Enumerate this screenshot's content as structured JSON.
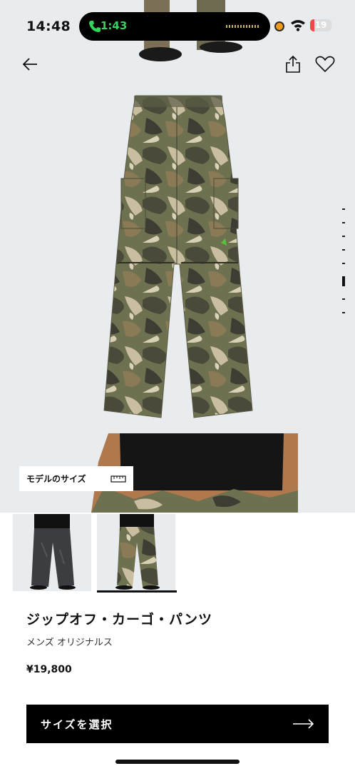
{
  "status_bar": {
    "time": "14:48",
    "call_time": "1:43",
    "battery": "19",
    "battery_level": 0.19
  },
  "nav": {
    "back_icon": "arrow-left-icon",
    "share_icon": "share-icon",
    "favorite_icon": "heart-icon"
  },
  "gallery": {
    "image_count": 8,
    "active_index": 6
  },
  "model_size": {
    "label": "モデルのサイズ",
    "icon": "ruler-icon"
  },
  "thumbnails": [
    {
      "colorway": "black"
    },
    {
      "colorway": "camo"
    }
  ],
  "product": {
    "title": "ジップオフ・カーゴ・パンツ",
    "category": "メンズ オリジナルス",
    "price": "¥19,800"
  },
  "cta": {
    "label": "サイズを選択",
    "icon": "arrow-right-icon"
  }
}
